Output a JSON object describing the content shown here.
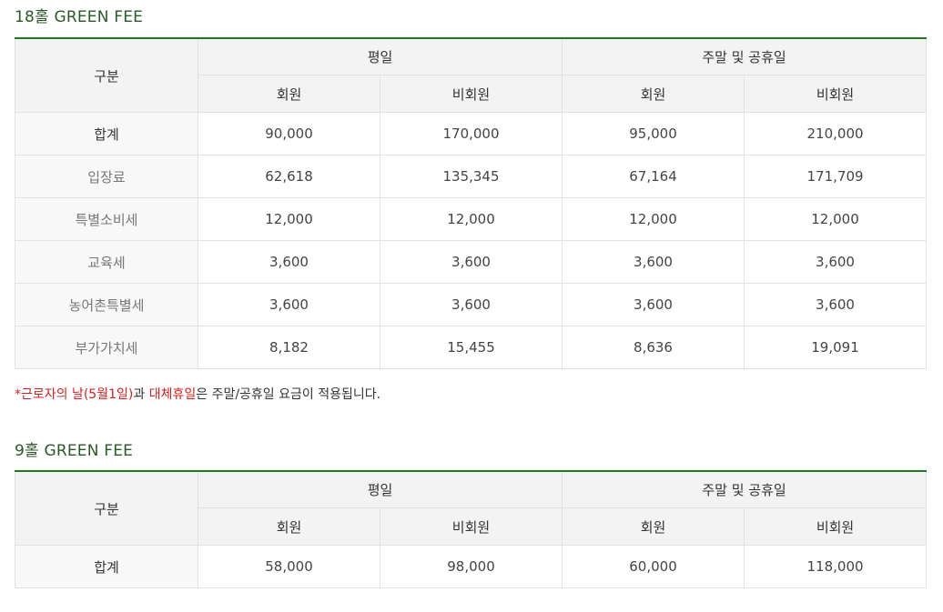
{
  "colors": {
    "accent_green": "#1e7a22",
    "title_green": "#2a5a2a",
    "holiday_red": "#d71e1e",
    "header_bg": "#f3f3f3"
  },
  "table18": {
    "title": "18홀 GREEN FEE",
    "col_category": "구분",
    "weekday": "평일",
    "weekend": "주말 및 공휴일",
    "member": "회원",
    "nonmember": "비회원",
    "rows": [
      {
        "label": "합계",
        "values": [
          "90,000",
          "170,000",
          "95,000",
          "210,000"
        ]
      },
      {
        "label": "입장료",
        "values": [
          "62,618",
          "135,345",
          "67,164",
          "171,709"
        ]
      },
      {
        "label": "특별소비세",
        "values": [
          "12,000",
          "12,000",
          "12,000",
          "12,000"
        ]
      },
      {
        "label": "교육세",
        "values": [
          "3,600",
          "3,600",
          "3,600",
          "3,600"
        ]
      },
      {
        "label": "농어촌특별세",
        "values": [
          "3,600",
          "3,600",
          "3,600",
          "3,600"
        ]
      },
      {
        "label": "부가가치세",
        "values": [
          "8,182",
          "15,455",
          "8,636",
          "19,091"
        ]
      }
    ]
  },
  "note": {
    "part1": "*근로자의 날(5월1일)",
    "part2": "과 ",
    "part3": "대체휴일",
    "part4": "은 주말/공휴일 요금이 적용됩니다."
  },
  "table9": {
    "title": "9홀 GREEN FEE",
    "col_category": "구분",
    "weekday": "평일",
    "weekend": "주말 및 공휴일",
    "member": "회원",
    "nonmember": "비회원",
    "rows": [
      {
        "label": "합계",
        "values": [
          "58,000",
          "98,000",
          "60,000",
          "118,000"
        ]
      }
    ]
  }
}
